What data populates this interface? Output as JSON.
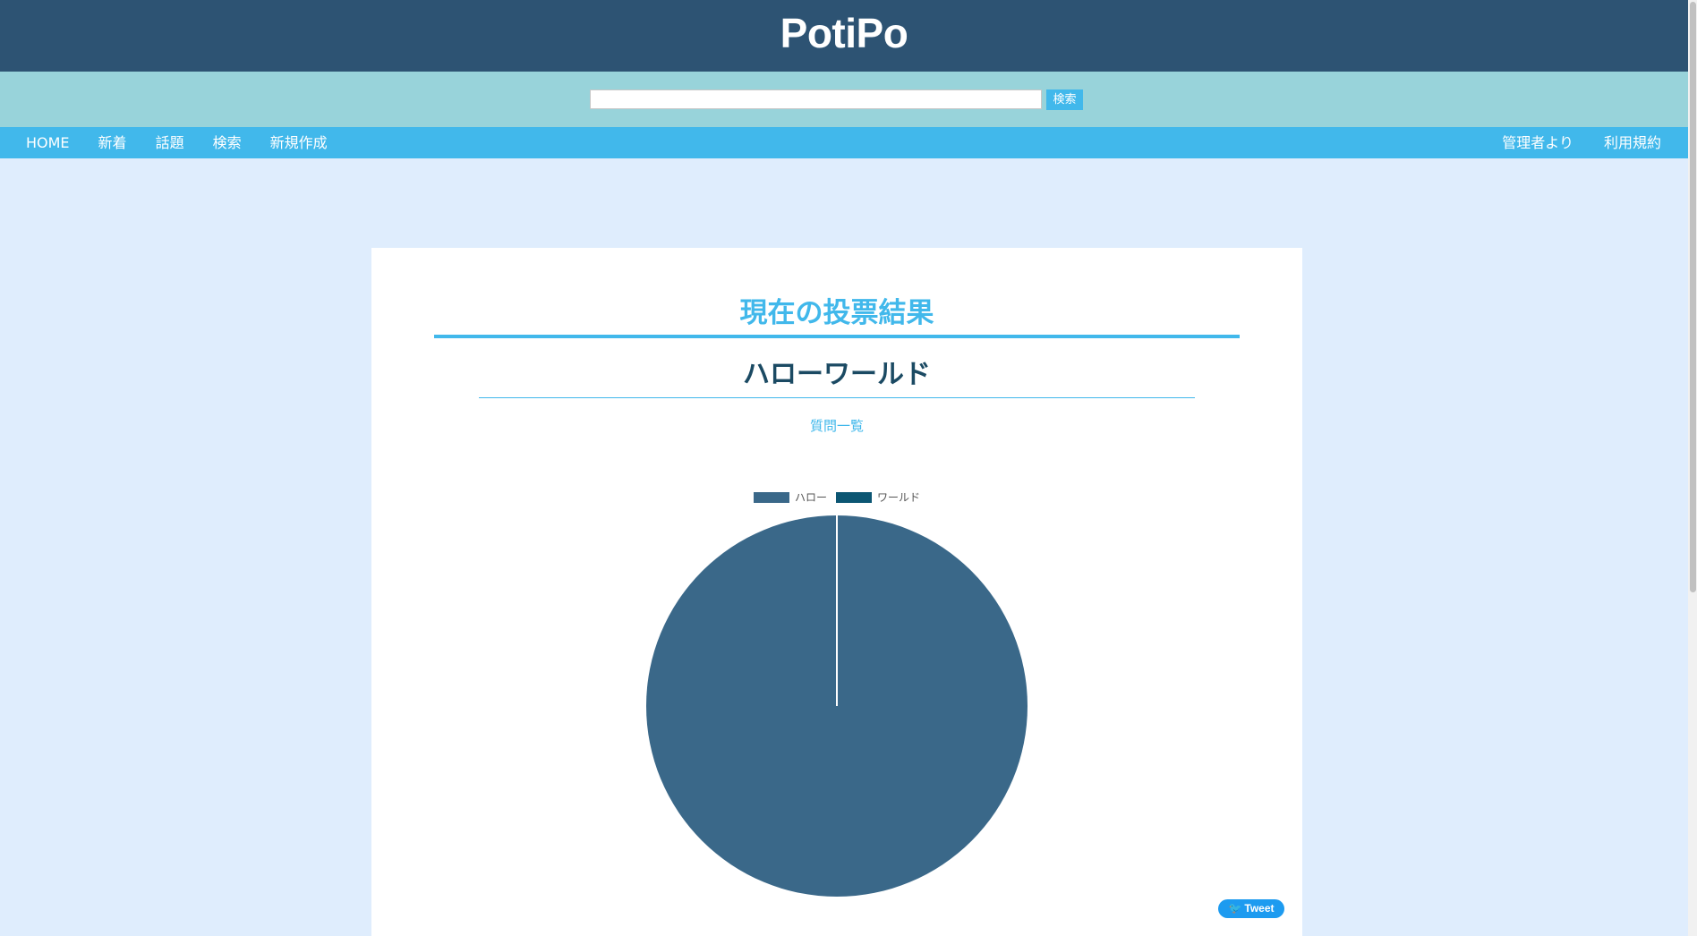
{
  "header": {
    "title": "PotiPo"
  },
  "search": {
    "input_value": "",
    "placeholder": "",
    "button_label": "検索"
  },
  "nav": {
    "left": [
      {
        "label": "HOME"
      },
      {
        "label": "新着"
      },
      {
        "label": "話題"
      },
      {
        "label": "検索"
      },
      {
        "label": "新規作成"
      }
    ],
    "right": [
      {
        "label": "管理者より"
      },
      {
        "label": "利用規約"
      }
    ]
  },
  "main": {
    "section_title": "現在の投票結果",
    "question_title": "ハローワールド",
    "question_list_link": "質問一覧",
    "tweet_label": "Tweet",
    "tweet_icon": "twitter-bird-icon"
  },
  "colors": {
    "header_bg": "#2d5373",
    "search_bg": "#98d3da",
    "nav_bg": "#41b8eb",
    "page_bg": "#dfedfd",
    "accent": "#41b8eb",
    "question_text": "#1b4a63"
  },
  "chart_data": {
    "type": "pie",
    "categories": [
      "ハロー",
      "ワールド"
    ],
    "values": [
      1,
      0
    ],
    "colors": [
      "#3a6889",
      "#0c5673"
    ],
    "legend_placement": "top-center"
  }
}
